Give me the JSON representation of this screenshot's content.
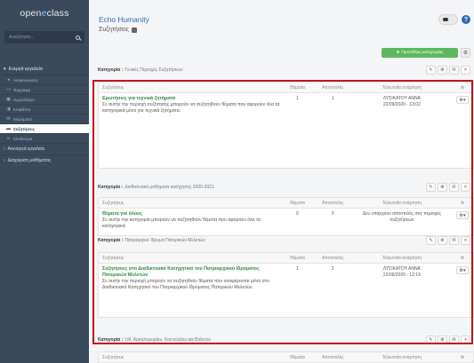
{
  "sidebar": {
    "logo_a": "open ",
    "logo_b": "e",
    "logo_c": "class",
    "search_placeholder": "Αναζήτηση...",
    "active_tools_header": "Ενεργά εργαλεία",
    "items": [
      {
        "label": "Ανακοινώσεις",
        "icon": "bullhorn-icon"
      },
      {
        "label": "Έγγραφα",
        "icon": "folder-icon"
      },
      {
        "label": "Ημερολόγιο",
        "icon": "calendar-icon"
      },
      {
        "label": "Κουβέντα",
        "icon": "chat-icon"
      },
      {
        "label": "Μηνύματα",
        "icon": "envelope-icon"
      },
      {
        "label": "Συζητήσεις",
        "icon": "comments-icon"
      },
      {
        "label": "Σύνδεσμοι",
        "icon": "link-icon"
      }
    ],
    "inactive_tools": "Ανενεργά εργαλεία",
    "course_admin": "Διαχείριση μαθήματος"
  },
  "header": {
    "course_title": "Echo Humanity",
    "page_title": "Συζητήσεις",
    "help": "?",
    "add_category": "Προσθήκη κατηγορίας"
  },
  "table_headers": {
    "forum": "Συζητήσεις",
    "topics": "Θέματα",
    "posts": "Αποστολές",
    "last_post": "Τελευταία ανάρτηση"
  },
  "category_prefix": "Κατηγορία :",
  "categories": [
    {
      "name": "Γενικές Περιοχές Συζητήσεων",
      "forum": {
        "title": "Ερωτήσεις για τεχνικά ζητήματα",
        "desc": "Σε αυτήν την περιοχή συζήτησης μπορούν να συζητηθούν θέματα που αφορούν όλα τα κατηγορικά μόνο για τεχνικά ζητήματα.",
        "topics": "1",
        "posts": "1",
        "last_author": "ΛΥΣΙΚΑΤΟΥ ΑΝΝΑ",
        "last_date": "22/09/2020 - 13:02"
      }
    },
    {
      "name": "Διαδικτυακά μαθήματα κατήχησης 2020-2021",
      "forum": {
        "title": "Θέματα για όλους",
        "desc": "Σε αυτήν την κατηγορία μπορούν να συζητηθούν θέματα που αφορούν όλα τα κατηγορικά.",
        "topics": "0",
        "posts": "0",
        "last_author": "Δεν υπάρχουν αποστολές στις περιοχές",
        "last_date": "συζητήσεων"
      }
    },
    {
      "name": "Πατριαρχικό Ίδρυμα Πατερικών Μελετών",
      "forum": {
        "title": "Συζητήσεις στο Διαδικτυακό Κατηχητικό του Πατριαρχικού Ιδρύματος Πατερικών Μελετών",
        "desc": "Σε αυτήν την περιοχή μπορούν να συζητηθούν θέματα που αναφέρονται μόνο στο Διαδικτυακό Κατηχητικό του Πατριαρχικού Ιδρύματος Πατερικών Μελετών.",
        "topics": "1",
        "posts": "2",
        "last_author": "ΛΥΣΙΚΑΤΟΥ ΑΝΝΑ",
        "last_date": "22/09/2020 - 12:19"
      }
    },
    {
      "name": "Ι.Μ. Αρκαλοχωρίου, Καστελλίου και Βιάννου"
    }
  ],
  "colors": {
    "sidebar": "#3a4a5c",
    "link": "#2a6cb0",
    "forum_title": "#2a8a3e",
    "add_button": "#5cb85c",
    "highlight": "#c0141c"
  }
}
